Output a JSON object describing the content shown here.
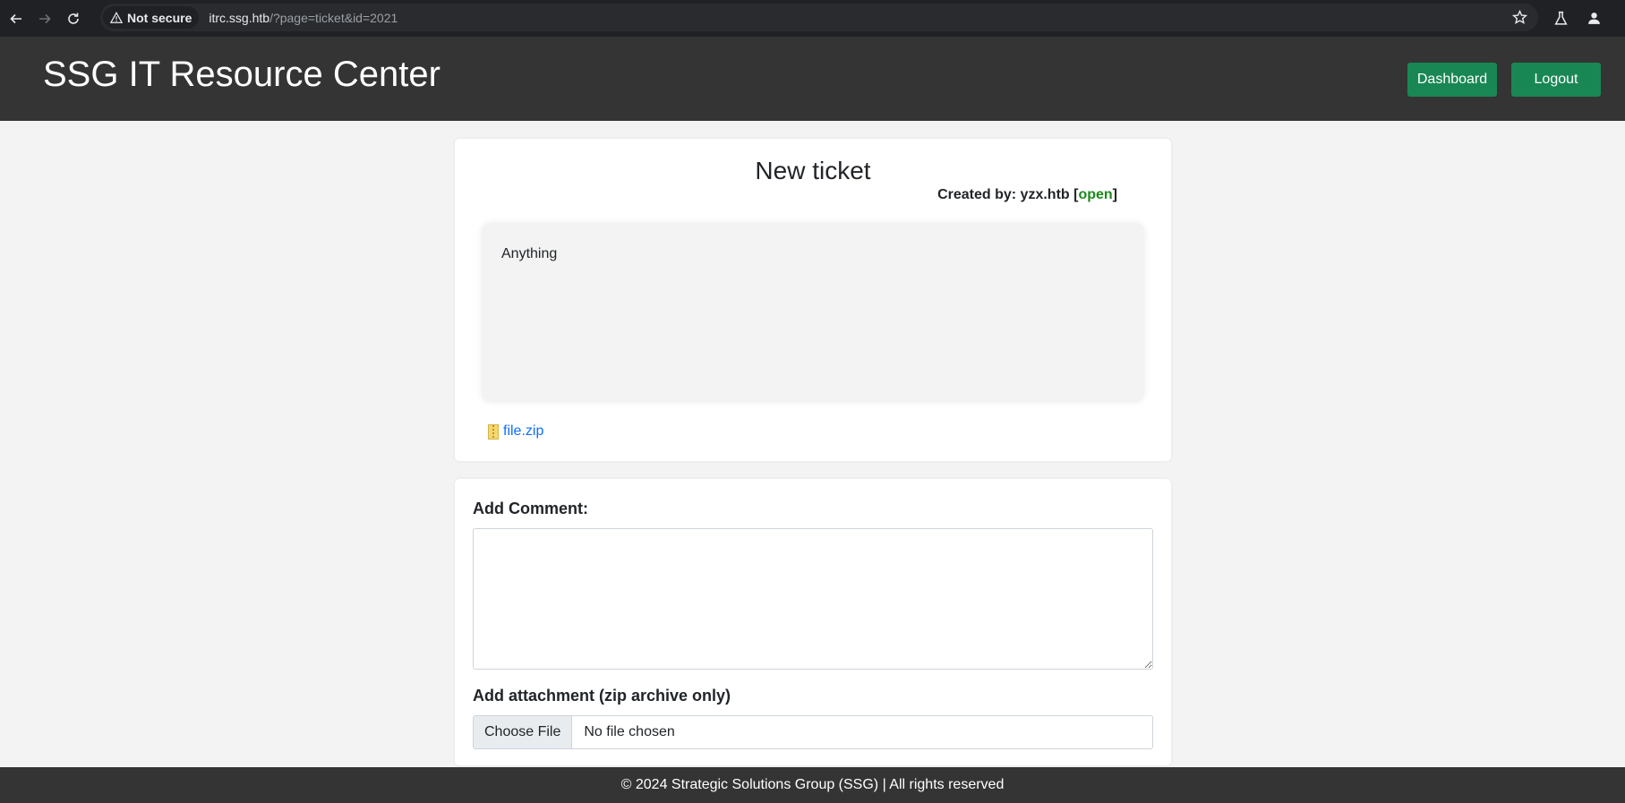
{
  "browser": {
    "security_label": "Not secure",
    "url_host": "itrc.ssg.htb",
    "url_rest": "/?page=ticket&id=2021"
  },
  "header": {
    "title": "SSG IT Resource Center",
    "dashboard_label": "Dashboard",
    "logout_label": "Logout",
    "accent_color": "#198754"
  },
  "ticket": {
    "title": "New ticket",
    "created_by_prefix": "Created by: ",
    "author": "yzx.htb",
    "status": "open",
    "body": "Anything",
    "attachment": "file.zip"
  },
  "comment_form": {
    "comment_label": "Add Comment:",
    "comment_value": "",
    "attachment_label": "Add attachment (zip archive only)",
    "choose_file_label": "Choose File",
    "no_file_text": "No file chosen"
  },
  "footer": {
    "text": "© 2024 Strategic Solutions Group (SSG) | All rights reserved"
  }
}
